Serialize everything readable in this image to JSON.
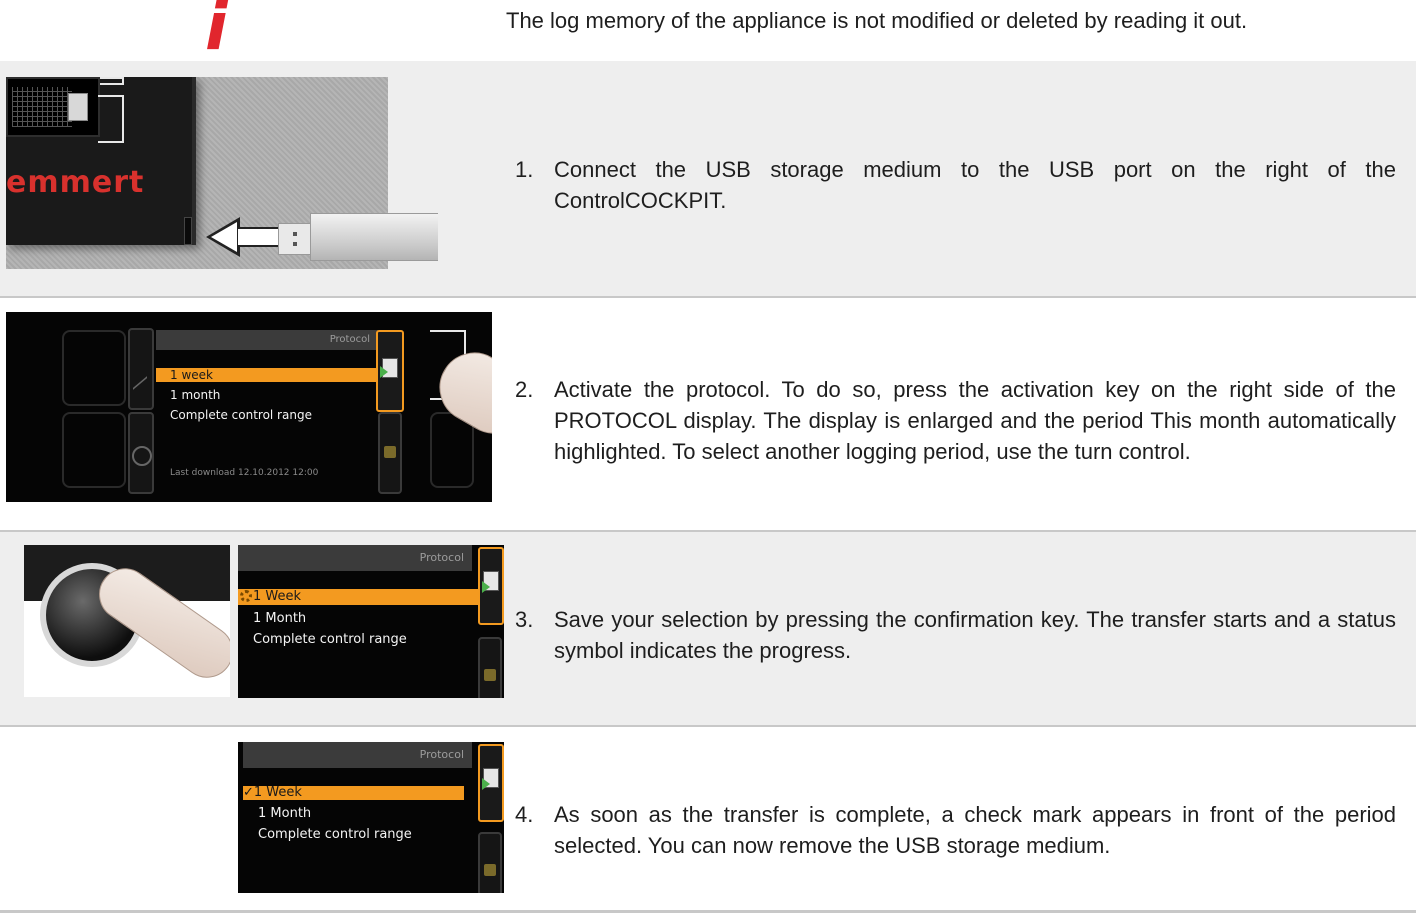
{
  "info": {
    "icon": "info-icon",
    "glyph": "i",
    "note": "The log memory of the appliance is not modified or deleted by reading it out."
  },
  "usb_image": {
    "brand": "emmert"
  },
  "steps": [
    {
      "number": "1.",
      "text": "Connect the USB storage medium to the USB port on the right of the ControlCOCKPIT."
    },
    {
      "number": "2.",
      "text": "Activate the protocol. To do so, press the activation key on the right side of the PROTOCOL display. The display is enlarged and the period This month automatically highlighted. To select another logging period, use the turn control."
    },
    {
      "number": "3.",
      "text": "Save your selection by pressing the confirmation key. The transfer starts and a status symbol indicates the progress."
    },
    {
      "number": "4.",
      "text": "As soon as the transfer is complete, a check mark appears in front of the period selected. You can now remove the USB storage medium."
    }
  ],
  "protocol_panels": [
    {
      "title": "Protocol",
      "options": [
        "1 week",
        "1 month",
        "Complete control range"
      ],
      "selected_index": 0,
      "footer": "Last download 12.10.2012   12:00"
    },
    {
      "title": "Protocol",
      "options": [
        "1 Week",
        "1 Month",
        "Complete control range"
      ],
      "selected_index": 0,
      "status_icon": "progress-spinner-icon"
    },
    {
      "title": "Protocol",
      "options": [
        "1 Week",
        "1 Month",
        "Complete control range"
      ],
      "selected_index": 0,
      "status_mark": "✓"
    }
  ]
}
